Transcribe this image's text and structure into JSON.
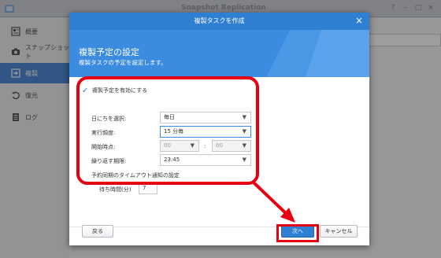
{
  "app": {
    "title": "Snapshot Replication",
    "sidebar": [
      {
        "label": "概要",
        "icon": "overview-icon"
      },
      {
        "label": "スナップショット",
        "icon": "camera-icon"
      },
      {
        "label": "複製",
        "icon": "replication-icon"
      },
      {
        "label": "復元",
        "icon": "restore-icon"
      },
      {
        "label": "ログ",
        "icon": "log-icon"
      }
    ]
  },
  "dialog": {
    "title": "複製タスクを作成",
    "heading": "複製予定の設定",
    "subheading": "複製タスクの予定を設定します。",
    "enable_schedule_label": "複製予定を有効にする",
    "fields": {
      "day_label": "日にちを選択:",
      "day_value": "毎日",
      "frequency_label": "実行頻度:",
      "frequency_value": "15 分毎",
      "start_label": "開始時点:",
      "start_hour": "00",
      "start_sep": ":",
      "start_minute": "00",
      "repeat_label": "繰り返す期限:",
      "repeat_value": "23:45",
      "timeout_section": "予約同期のタイムアウト通知の設定",
      "wait_label": "待ち時間(分)",
      "wait_value": "7"
    },
    "buttons": {
      "back": "戻る",
      "next": "次へ",
      "cancel": "キャンセル"
    }
  },
  "colors": {
    "accent": "#2f7fd2",
    "annotation": "#e60012"
  }
}
